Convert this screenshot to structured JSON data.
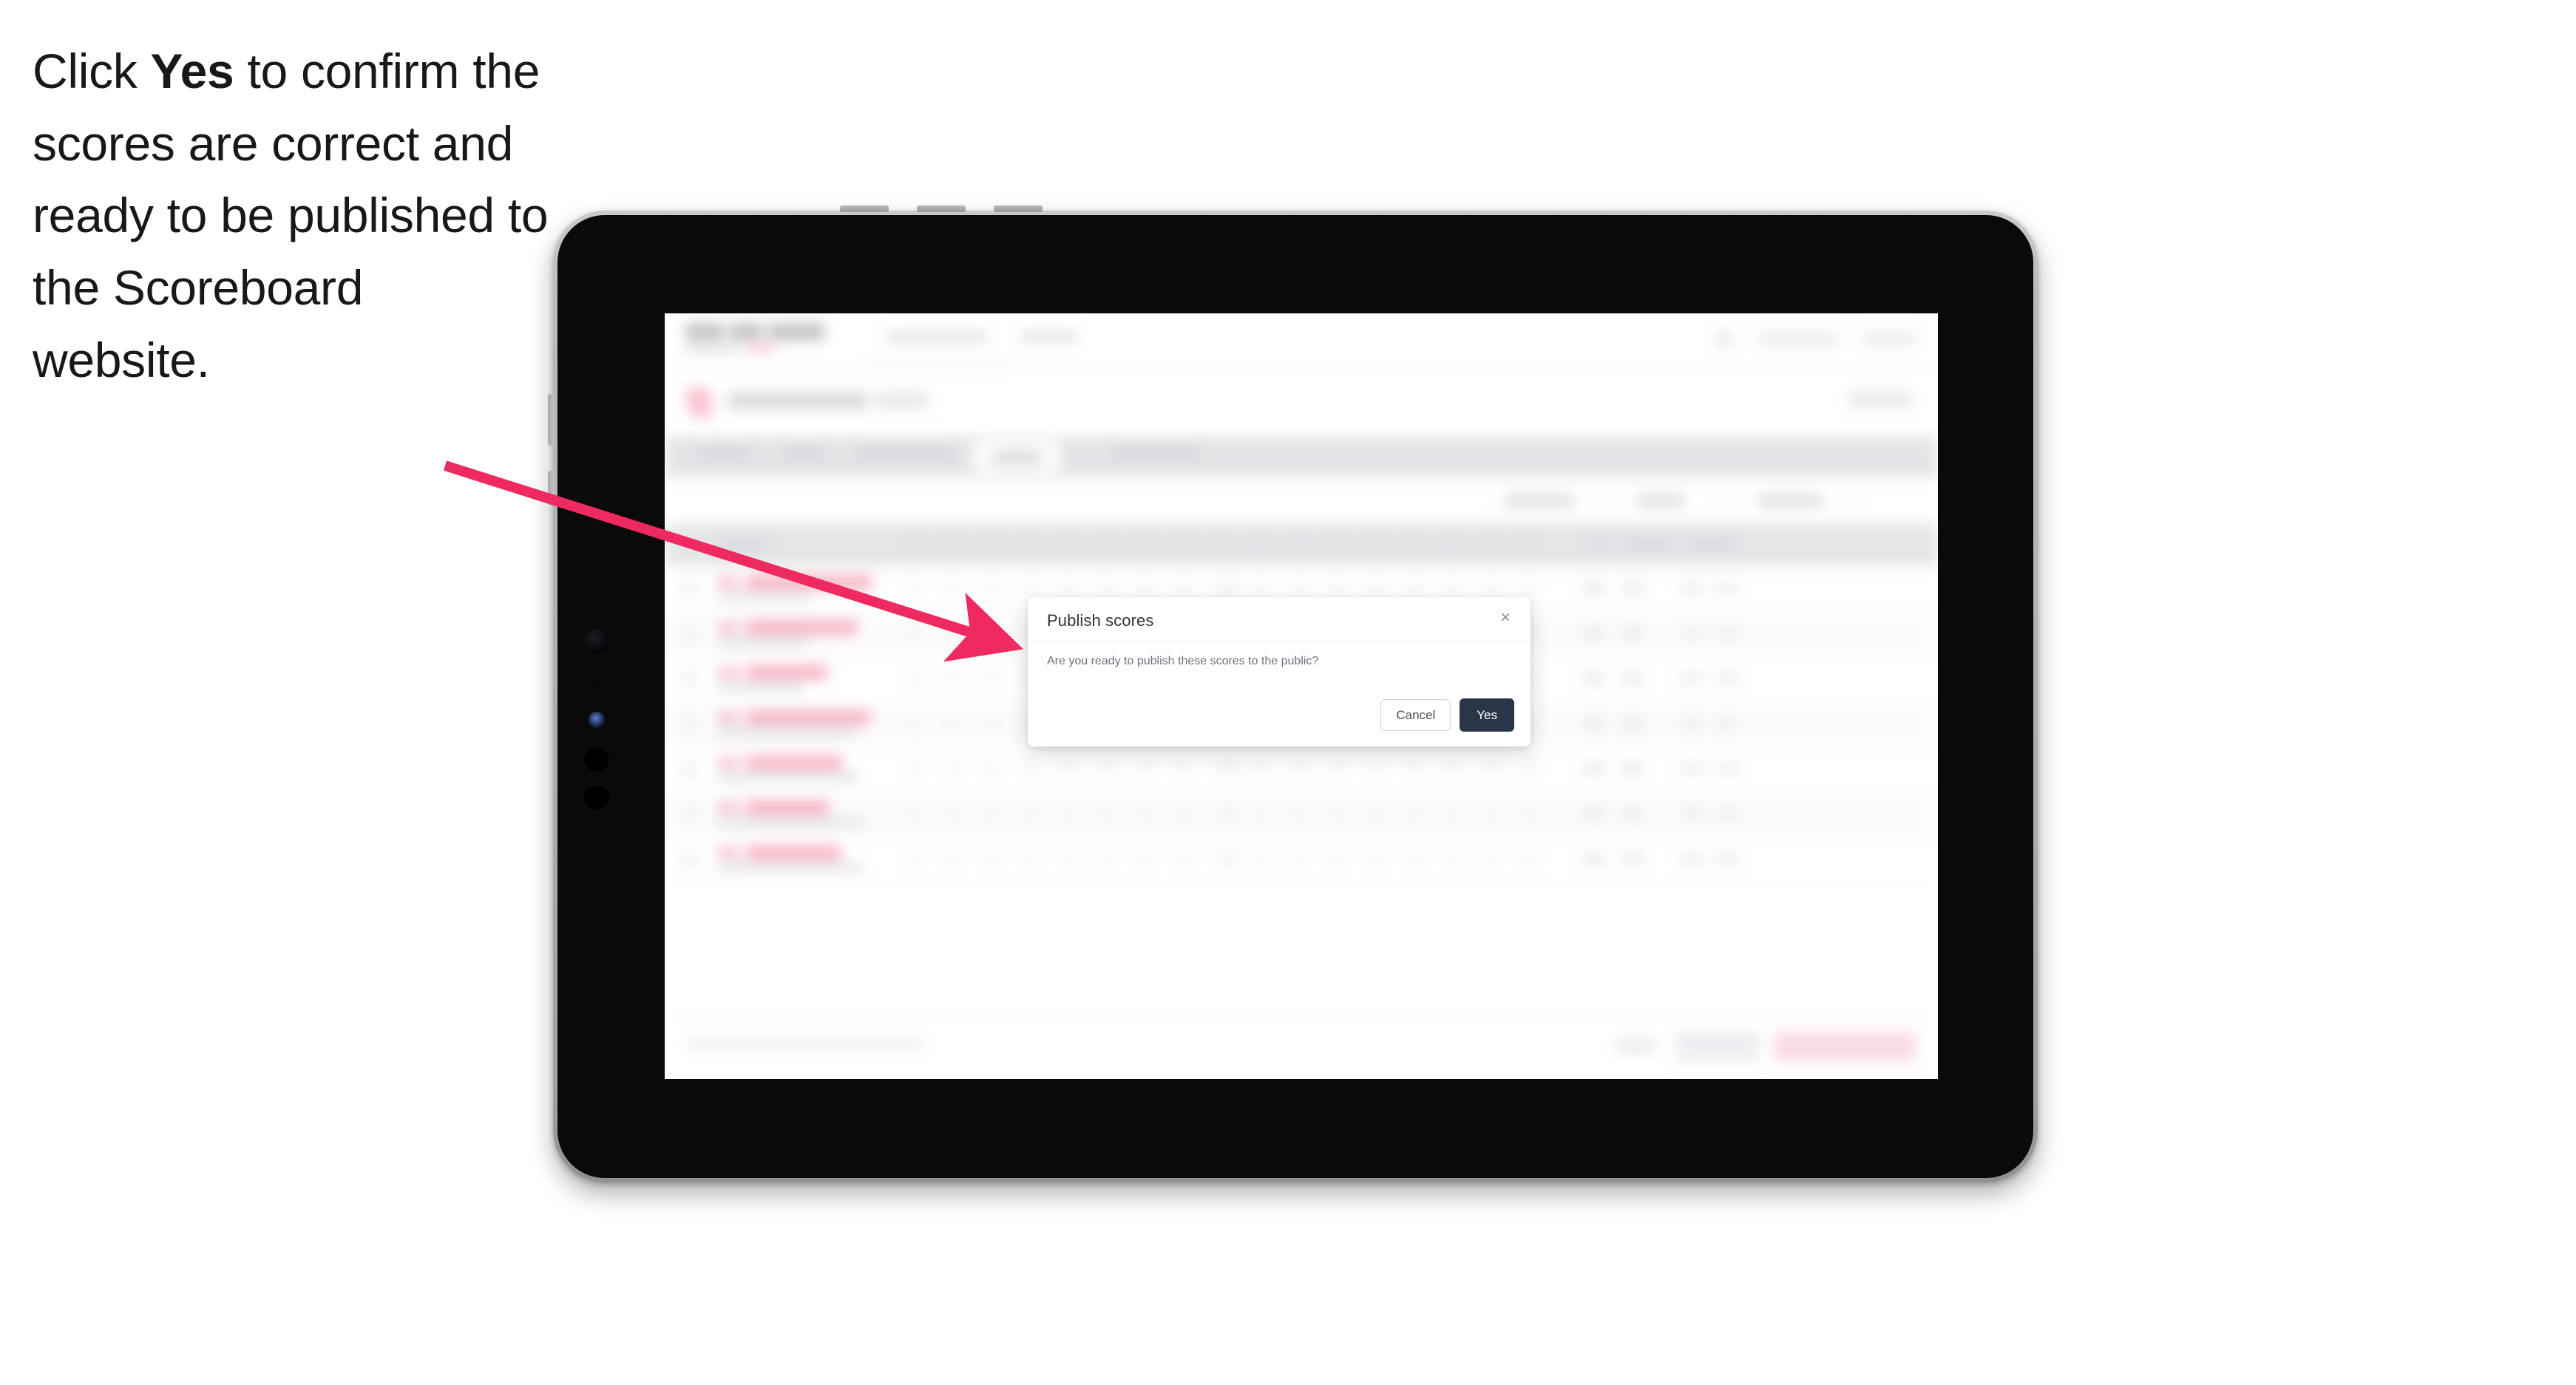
{
  "instruction": {
    "prefix": "Click ",
    "keyword": "Yes",
    "suffix": " to confirm the scores are correct and ready to be published to the Scoreboard website."
  },
  "annotation": {
    "arrow_color": "#EE2A60",
    "target": "yes-button"
  },
  "device": {
    "type": "tablet",
    "orientation": "landscape",
    "bezel_color": "#0a0a0a",
    "frame_color": "#b4b6b8"
  },
  "modal": {
    "title": "Publish scores",
    "body": "Are you ready to publish these scores to the public?",
    "close_icon": "close-icon",
    "close_glyph": "×",
    "cancel_label": "Cancel",
    "confirm_label": "Yes",
    "confirm_color": "#2a3648",
    "cancel_border_color": "#c9d6ea"
  },
  "app": {
    "accent_color": "#f2567f",
    "header": {
      "brand": "",
      "nav": [
        "",
        ""
      ],
      "right_links": [
        "",
        ""
      ]
    },
    "tabs": {
      "count": 5,
      "active_index": 3
    },
    "filters": [
      "",
      "",
      ""
    ],
    "table": {
      "row_count": 7,
      "score_column_count": 17
    },
    "footer": {
      "note": "",
      "link": "",
      "secondary_button": "",
      "primary_button": ""
    }
  }
}
